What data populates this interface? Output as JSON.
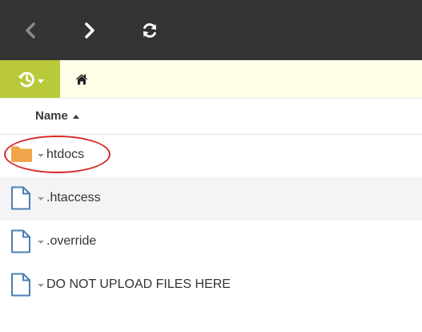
{
  "toolbar": {
    "back_icon": "chevron-left-icon",
    "forward_icon": "chevron-right-icon",
    "refresh_icon": "refresh-icon",
    "back_color": "#8a8a8a",
    "forward_color": "#ffffff",
    "refresh_color": "#ffffff"
  },
  "bar2": {
    "history_icon": "history-icon",
    "history_color": "#b9c93a",
    "home_icon": "home-icon"
  },
  "list": {
    "header": {
      "name_label": "Name"
    },
    "items": [
      {
        "name": "htdocs",
        "type": "folder",
        "icon": "folder-icon"
      },
      {
        "name": ".htaccess",
        "type": "file",
        "icon": "file-icon"
      },
      {
        "name": ".override",
        "type": "file",
        "icon": "file-icon"
      },
      {
        "name": "DO NOT UPLOAD FILES HERE",
        "type": "file",
        "icon": "file-icon"
      }
    ]
  },
  "colors": {
    "toolbar_bg": "#333333",
    "breadcrumb_bg": "#fdfde8",
    "folder": "#f0a54a",
    "file_outline": "#4a7fb5",
    "highlight": "#d82828"
  }
}
